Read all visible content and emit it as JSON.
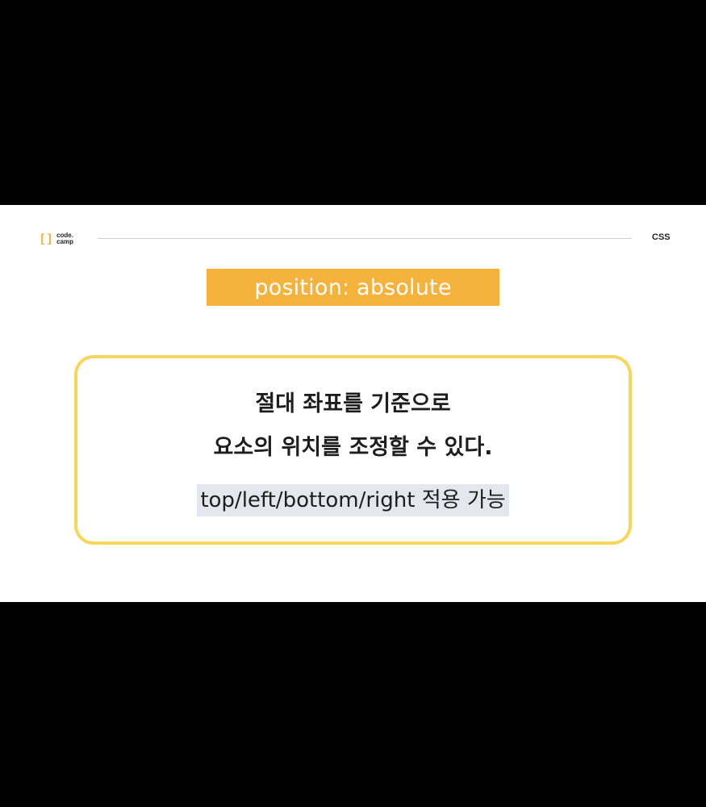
{
  "header": {
    "logo": {
      "bracket_left": "[",
      "bracket_right": "]",
      "line1": "code.",
      "line2": "camp"
    },
    "subject": "CSS"
  },
  "slide": {
    "title": "position: absolute",
    "body": {
      "line1": "절대 좌표를 기준으로",
      "line2": "요소의 위치를 조정할 수 있다.",
      "note": "top/left/bottom/right 적용 가능"
    }
  },
  "colors": {
    "accent_orange": "#f5b23d",
    "card_border_yellow": "#f8d65c",
    "note_highlight": "#e6e6ef",
    "letterbox": "#000000"
  }
}
